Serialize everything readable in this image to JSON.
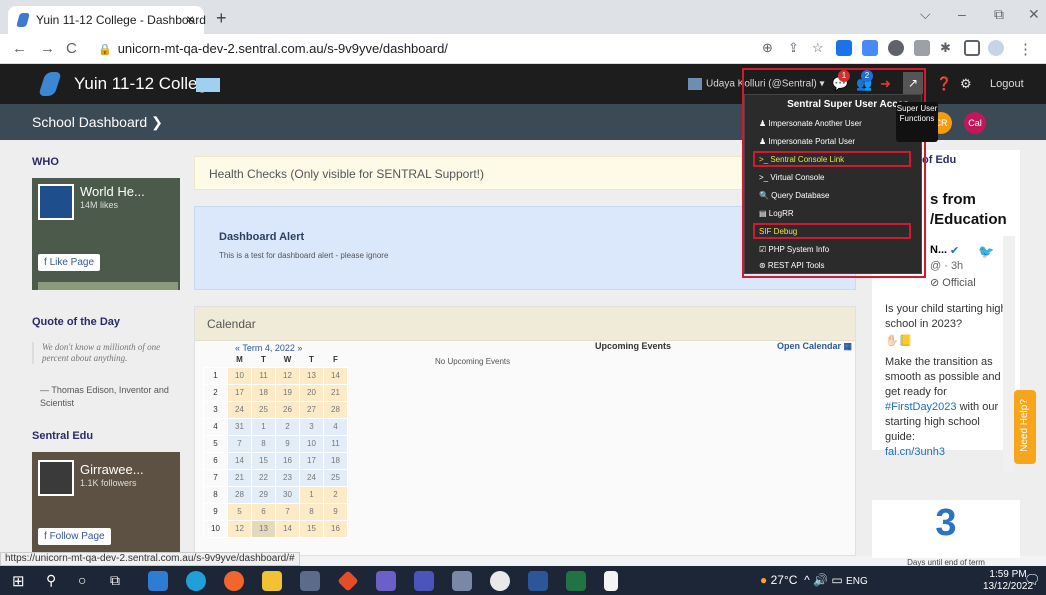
{
  "browser": {
    "tab_title": "Yuin 11-12 College - Dashboard",
    "close": "×",
    "new_tab": "+",
    "back": "←",
    "forward": "→",
    "reload": "C",
    "url": "unicorn-mt-qa-dev-2.sentral.com.au/s-9v9yve/dashboard/",
    "window_minimize": "–",
    "window_restore": "⧉",
    "window_close": "✕"
  },
  "header": {
    "college": "Yuin 11-12 College",
    "user": "Udaya Kolluri (@Sentral) ▾",
    "badge_msgs": "1",
    "badge_people": "2",
    "logout": "Logout",
    "super_btn": "↗"
  },
  "subheader": {
    "dashboard": "School Dashboard ❯",
    "pill_cr": "CR",
    "pill_cal": "Cal"
  },
  "sidebar": {
    "who": "WHO",
    "who_page_name": "World He...",
    "who_likes": "14M likes",
    "like_page": "Like Page",
    "quote_heading": "Quote of the Day",
    "quote_text": "We don't know a millionth of one percent about anything.",
    "quote_author": "— Thomas Edison, Inventor and Scientist",
    "sentral_edu": "Sentral Edu",
    "girr_name": "Girrawee...",
    "girr_followers": "1.1K followers",
    "follow_page": "Follow Page"
  },
  "main": {
    "health": "Health Checks (Only visible for SENTRAL Support!)",
    "alert_title": "Dashboard Alert",
    "alert_body": "This is a test for dashboard alert - please ignore",
    "calendar_title": "Calendar",
    "term": "« Term 4, 2022 »",
    "upcoming": "Upcoming Events",
    "open_calendar": "Open Calendar ▦",
    "no_events": "No Upcoming Events",
    "days": [
      "M",
      "T",
      "W",
      "T",
      "F"
    ],
    "weeks": [
      {
        "w": "1",
        "d": [
          "10",
          "11",
          "12",
          "13",
          "14"
        ],
        "c": "y"
      },
      {
        "w": "2",
        "d": [
          "17",
          "18",
          "19",
          "20",
          "21"
        ],
        "c": "y"
      },
      {
        "w": "3",
        "d": [
          "24",
          "25",
          "26",
          "27",
          "28"
        ],
        "c": "y"
      },
      {
        "w": "4",
        "d": [
          "31",
          "1",
          "2",
          "3",
          "4"
        ],
        "c": "b"
      },
      {
        "w": "5",
        "d": [
          "7",
          "8",
          "9",
          "10",
          "11"
        ],
        "c": "b"
      },
      {
        "w": "6",
        "d": [
          "14",
          "15",
          "16",
          "17",
          "18"
        ],
        "c": "b"
      },
      {
        "w": "7",
        "d": [
          "21",
          "22",
          "23",
          "24",
          "25"
        ],
        "c": "b"
      },
      {
        "w": "8",
        "d": [
          "28",
          "29",
          "30",
          "1",
          "2"
        ],
        "c": "m"
      },
      {
        "w": "9",
        "d": [
          "5",
          "6",
          "7",
          "8",
          "9"
        ],
        "c": "y"
      },
      {
        "w": "10",
        "d": [
          "12",
          "13",
          "14",
          "15",
          "16"
        ],
        "c": "y"
      }
    ]
  },
  "rightcol": {
    "heading": "of Edu",
    "from": "s from",
    "edu": "/Education",
    "tw_name": "N...",
    "tw_time": "@ · 3h",
    "official": "⊘ Official",
    "tweet1": "Is your child starting high school in 2023?",
    "tweet2": "Make the transition as smooth as possible and get ready for",
    "hashtag": "#FirstDay2023",
    "tweet3": " with our starting high school guide:",
    "link": "fal.cn/3unh3",
    "need_help": "Need Help?",
    "days_num": "3",
    "days_label": "Days until end of term"
  },
  "menu": {
    "title": "Sentral Super User Acces",
    "items": [
      "♟ Impersonate Another User",
      "♟ Impersonate Portal User",
      ">_ Sentral Console Link",
      ">_ Virtual Console",
      "🔍 Query Database",
      "▤ LogRR",
      "SIF Debug",
      "☑ PHP System Info",
      "⊛ REST API Tools"
    ],
    "tooltip": "Super User Functions"
  },
  "status_url": "https://unicorn-mt-qa-dev-2.sentral.com.au/s-9v9yve/dashboard/#",
  "taskbar": {
    "temp": "27°C",
    "lang": "ENG",
    "time": "1:59 PM",
    "date": "13/12/2022"
  },
  "colors": {
    "accent": "#2a74c4",
    "highlight": "#d3182f",
    "header": "#1d1d1d"
  }
}
